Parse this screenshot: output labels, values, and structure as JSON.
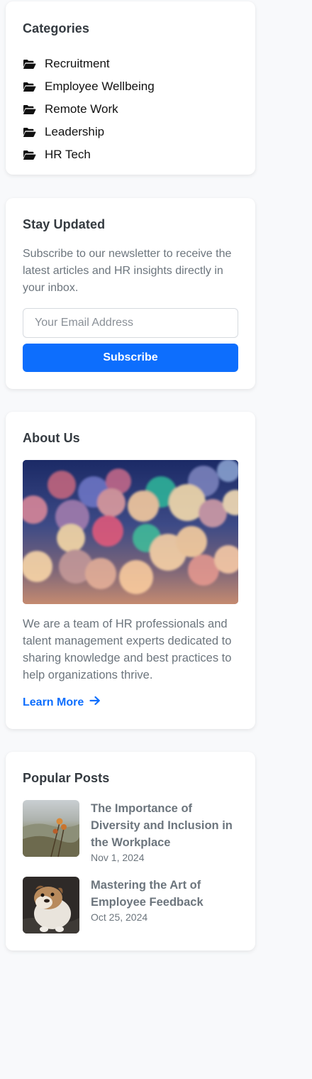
{
  "categories": {
    "title": "Categories",
    "items": [
      {
        "label": "Recruitment",
        "icon": "folder-open-icon"
      },
      {
        "label": "Employee Wellbeing",
        "icon": "folder-open-icon"
      },
      {
        "label": "Remote Work",
        "icon": "folder-open-icon"
      },
      {
        "label": "Leadership",
        "icon": "folder-open-icon"
      },
      {
        "label": "HR Tech",
        "icon": "folder-open-icon"
      }
    ]
  },
  "newsletter": {
    "title": "Stay Updated",
    "description": "Subscribe to our newsletter to receive the latest articles and HR insights directly in your inbox.",
    "email_placeholder": "Your Email Address",
    "email_value": "",
    "button_label": "Subscribe"
  },
  "about": {
    "title": "About Us",
    "description": "We are a team of HR professionals and talent management experts dedicated to sharing knowledge and best practices to help organizations thrive.",
    "link_label": "Learn More",
    "link_icon": "arrow-right-icon"
  },
  "popular": {
    "title": "Popular Posts",
    "posts": [
      {
        "title": "The Importance of Diversity and Inclusion in the Workplace",
        "date": "Nov 1, 2024"
      },
      {
        "title": "Mastering the Art of Employee Feedback",
        "date": "Oct 25, 2024"
      }
    ]
  },
  "colors": {
    "accent": "#0d6efd",
    "heading": "#343a40",
    "muted": "#6c757d",
    "background": "#f8f9fb"
  }
}
